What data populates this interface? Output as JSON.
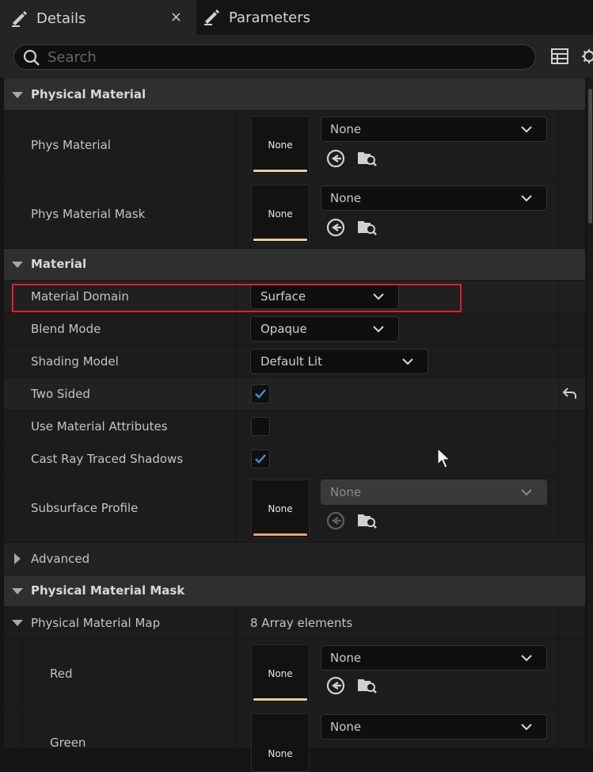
{
  "tabs": [
    {
      "label": "Details",
      "icon": "pencil-icon",
      "active": true,
      "close": "×"
    },
    {
      "label": "Parameters",
      "icon": "pencil-icon",
      "active": false
    }
  ],
  "search": {
    "placeholder": "Search",
    "value": ""
  },
  "sections": {
    "physical_material": {
      "title": "Physical Material",
      "phys_material": {
        "label": "Phys Material",
        "thumb": "None",
        "value": "None"
      },
      "phys_material_mask": {
        "label": "Phys Material Mask",
        "thumb": "None",
        "value": "None"
      }
    },
    "material": {
      "title": "Material",
      "material_domain": {
        "label": "Material Domain",
        "value": "Surface"
      },
      "blend_mode": {
        "label": "Blend Mode",
        "value": "Opaque"
      },
      "shading_model": {
        "label": "Shading Model",
        "value": "Default Lit"
      },
      "two_sided": {
        "label": "Two Sided",
        "checked": true
      },
      "use_material_attributes": {
        "label": "Use Material Attributes",
        "checked": false
      },
      "cast_ray_traced_shadows": {
        "label": "Cast Ray Traced Shadows",
        "checked": true
      },
      "subsurface_profile": {
        "label": "Subsurface Profile",
        "thumb": "None",
        "value": "None",
        "disabled": true
      },
      "advanced": {
        "label": "Advanced"
      }
    },
    "physical_material_mask": {
      "title": "Physical Material Mask",
      "physical_material_map": {
        "label": "Physical Material Map",
        "value": "8 Array elements"
      },
      "red": {
        "label": "Red",
        "thumb": "None",
        "value": "None"
      },
      "green": {
        "label": "Green",
        "thumb": "None",
        "value": "None"
      }
    }
  },
  "colors": {
    "accent_highlight": "#e0202e",
    "check": "#3d8fe0",
    "thumb_bar": "#e7cf9a"
  }
}
